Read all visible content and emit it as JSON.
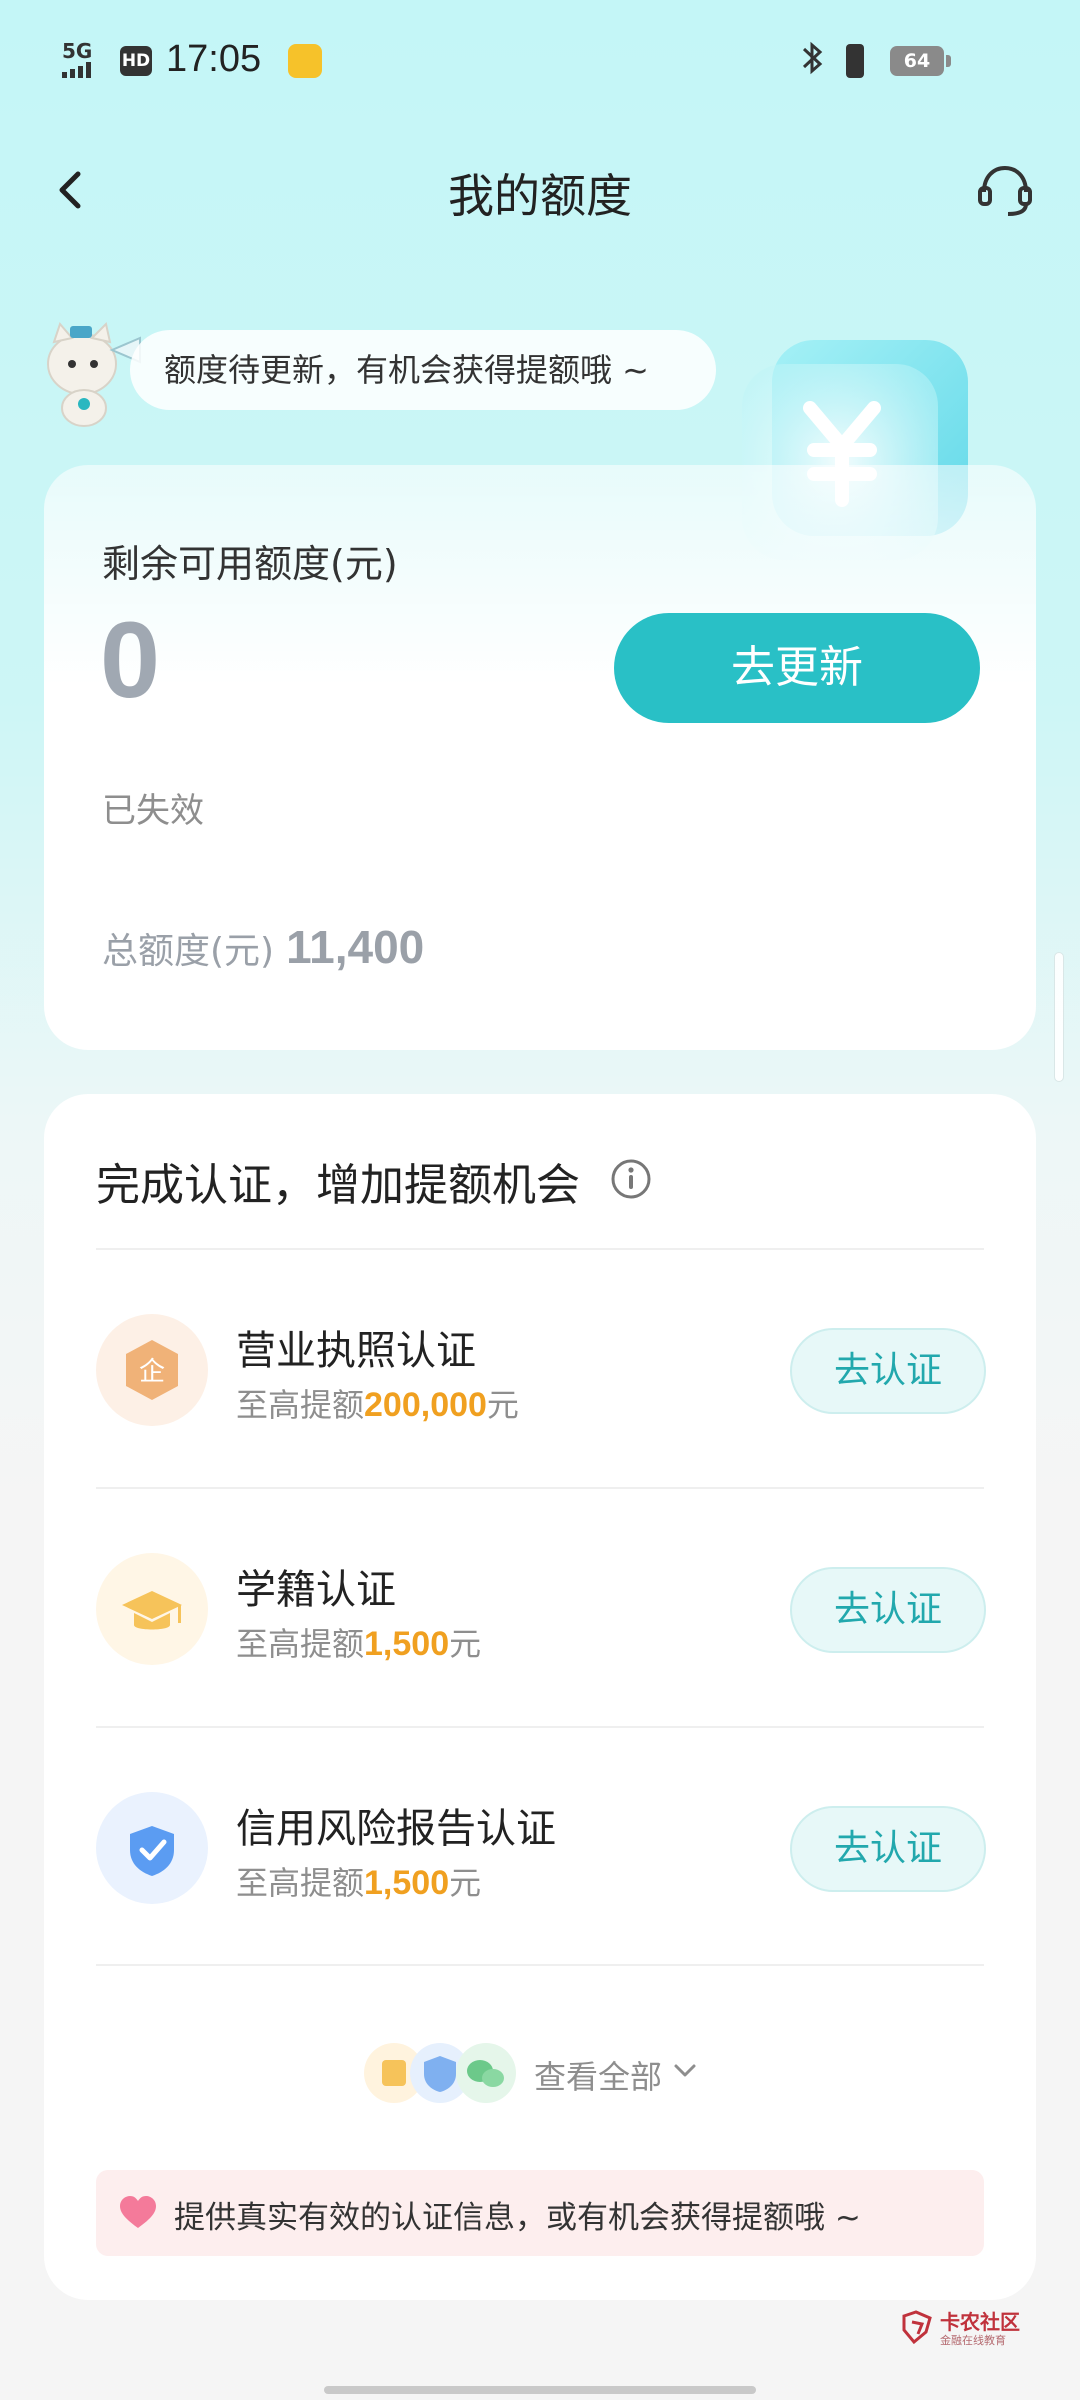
{
  "status_bar": {
    "network": "5G",
    "hd": "HD",
    "time": "17:05",
    "battery": "64"
  },
  "nav": {
    "title": "我的额度"
  },
  "tip": {
    "text": "额度待更新，有机会获得提额哦 ~"
  },
  "credit": {
    "label": "剩余可用额度(元)",
    "amount": "0",
    "update_button": "去更新",
    "status": "已失效",
    "total_label": "总额度(元)",
    "total_value": "11,400"
  },
  "verification": {
    "title": "完成认证，增加提额机会",
    "items": [
      {
        "name": "营业执照认证",
        "desc_prefix": "至高提额",
        "amount": "200,000",
        "desc_suffix": "元",
        "button": "去认证",
        "icon": "business-license-icon"
      },
      {
        "name": "学籍认证",
        "desc_prefix": "至高提额",
        "amount": "1,500",
        "desc_suffix": "元",
        "button": "去认证",
        "icon": "graduation-cap-icon"
      },
      {
        "name": "信用风险报告认证",
        "desc_prefix": "至高提额",
        "amount": "1,500",
        "desc_suffix": "元",
        "button": "去认证",
        "icon": "shield-check-icon"
      }
    ],
    "view_all": "查看全部",
    "notice": "提供真实有效的认证信息，或有机会获得提额哦 ~"
  },
  "watermark": {
    "title": "卡农社区",
    "subtitle": "金融在线教育"
  },
  "colors": {
    "accent": "#29c0c6",
    "highlight_amount": "#f0a020",
    "button_text": "#22a8ad"
  }
}
